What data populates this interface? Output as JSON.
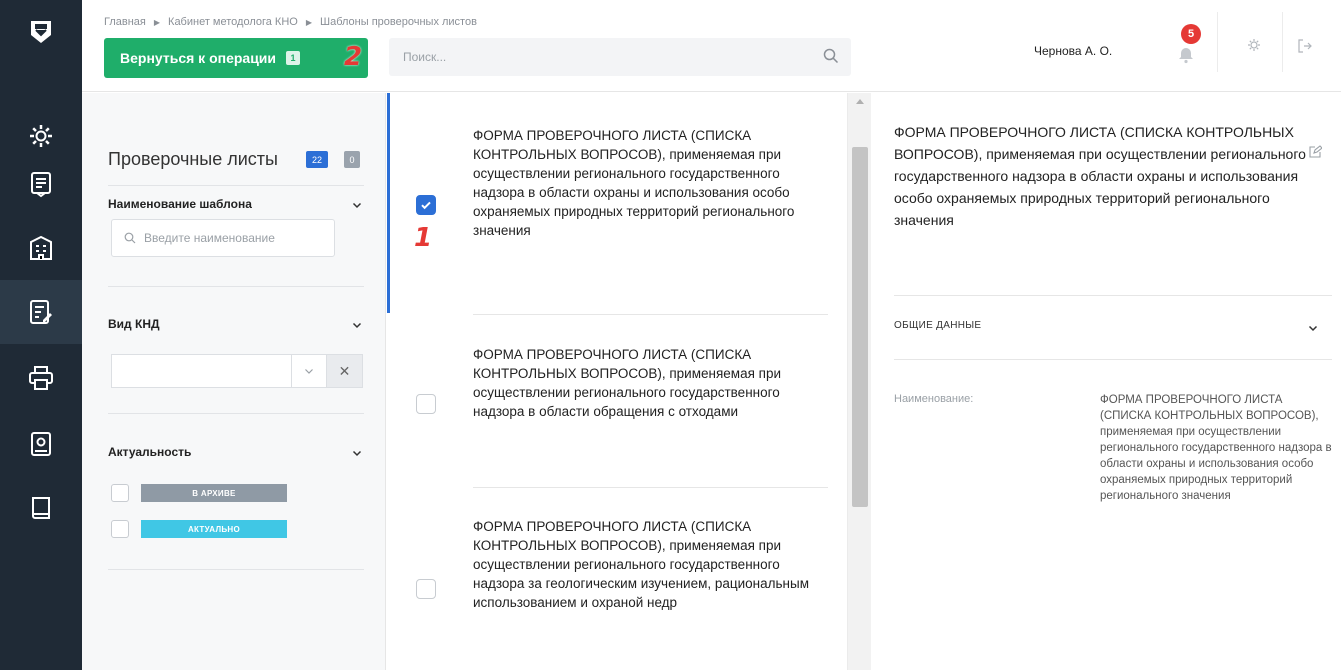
{
  "breadcrumb": [
    "Главная",
    "Кабинет методолога КНО",
    "Шаблоны проверочных листов"
  ],
  "header": {
    "back_button": "Вернуться к операции",
    "back_badge": "1",
    "marker_2": "2",
    "search_placeholder": "Поиск...",
    "user_name": "Чернова А. О.",
    "notifications_count": "5"
  },
  "sidebar_icons": [
    "logo-icon",
    "settings-icon",
    "document-icon",
    "building-icon",
    "checklist-icon",
    "printer-icon",
    "book-gear-icon",
    "book-icon"
  ],
  "filters": {
    "title": "Проверочные листы",
    "count_total": "22",
    "count_other": "0",
    "name_label": "Наименование шаблона",
    "name_placeholder": "Введите наименование",
    "knd_label": "Вид КНД",
    "relevance_label": "Актуальность",
    "status_archive": "В АРХИВЕ",
    "status_actual": "АКТУАЛЬНО"
  },
  "list": {
    "marker_1": "1",
    "items": [
      {
        "text": "ФОРМА ПРОВЕРОЧНОГО ЛИСТА (СПИСКА КОНТРОЛЬНЫХ ВОПРОСОВ), применяемая при осуществлении регионального государственного надзора в области охраны и использования особо охраняемых природных территорий регионального значения",
        "checked": true
      },
      {
        "text": "ФОРМА ПРОВЕРОЧНОГО ЛИСТА (СПИСКА КОНТРОЛЬНЫХ ВОПРОСОВ), применяемая при осуществлении регионального государственного надзора в области обращения с отходами",
        "checked": false
      },
      {
        "text": "ФОРМА ПРОВЕРОЧНОГО ЛИСТА (СПИСКА КОНТРОЛЬНЫХ ВОПРОСОВ), применяемая при осуществлении регионального государственного надзора за геологическим изучением, рациональным использованием и охраной недр",
        "checked": false
      }
    ]
  },
  "details": {
    "title": "ФОРМА ПРОВЕРОЧНОГО ЛИСТА (СПИСКА КОНТРОЛЬНЫХ ВОПРОСОВ), применяемая при осуществлении регионального государственного надзора в области охраны и использования особо охраняемых природных территорий регионального значения",
    "section": "ОБЩИЕ ДАННЫЕ",
    "name_label": "Наименование:",
    "name_value": "ФОРМА ПРОВЕРОЧНОГО ЛИСТА (СПИСКА КОНТРОЛЬНЫХ ВОПРОСОВ), применяемая при осуществлении регионального государственного надзора в области охраны и использования особо охраняемых природных территорий регионального значения"
  },
  "colors": {
    "rail": "#1f2a36",
    "primary_green": "#1fae6a",
    "accent_blue": "#2c6fd6",
    "notification_red": "#e53935",
    "tag_archive": "#8f9aa5",
    "tag_actual": "#40c7e5"
  }
}
